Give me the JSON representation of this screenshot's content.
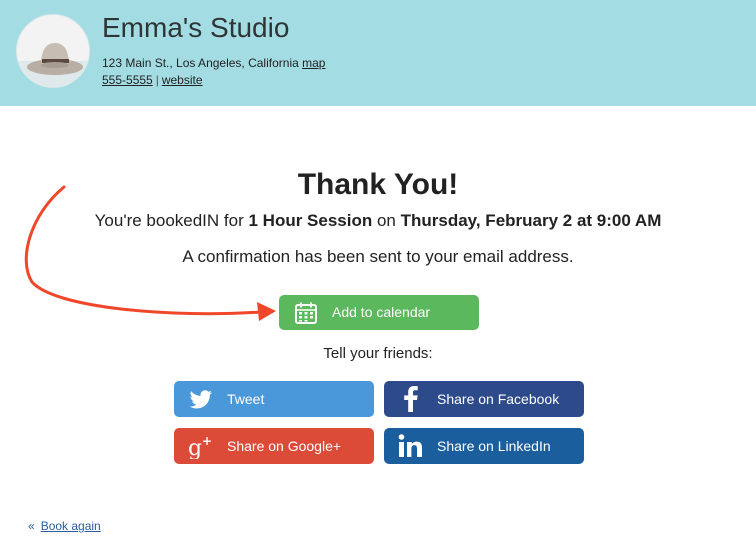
{
  "header": {
    "studio_name": "Emma's Studio",
    "address": "123 Main St., Los Angeles, California",
    "map_link": "map",
    "phone": "555-5555",
    "separator": "|",
    "website_link": "website"
  },
  "main": {
    "title": "Thank You!",
    "booked_prefix": "You're bookedIN for ",
    "booked_session": "1 Hour Session",
    "booked_on": " on ",
    "booked_datetime": "Thursday, February 2 at 9:00 AM",
    "confirmation": "A confirmation has been sent to your email address.",
    "calendar_button": "Add to calendar",
    "tell_friends": "Tell your friends:"
  },
  "share": {
    "tweet": "Tweet",
    "facebook": "Share on Facebook",
    "google": "Share on Google+",
    "linkedin": "Share on LinkedIn"
  },
  "footer": {
    "chevron": "«",
    "book_again": "Book again"
  },
  "colors": {
    "header_bg": "#a3dde3",
    "calendar_green": "#5cb85c",
    "twitter_blue": "#4a97d9",
    "facebook_blue": "#2d4a8a",
    "google_red": "#dc4a38",
    "linkedin_blue": "#1a5e9e",
    "annotation_arrow": "#f0462a"
  },
  "icons": {
    "avatar": "hat-avatar",
    "calendar": "calendar-icon",
    "tweet": "twitter-bird-icon",
    "facebook": "facebook-f-icon",
    "google": "google-plus-icon",
    "linkedin": "linkedin-in-icon"
  }
}
